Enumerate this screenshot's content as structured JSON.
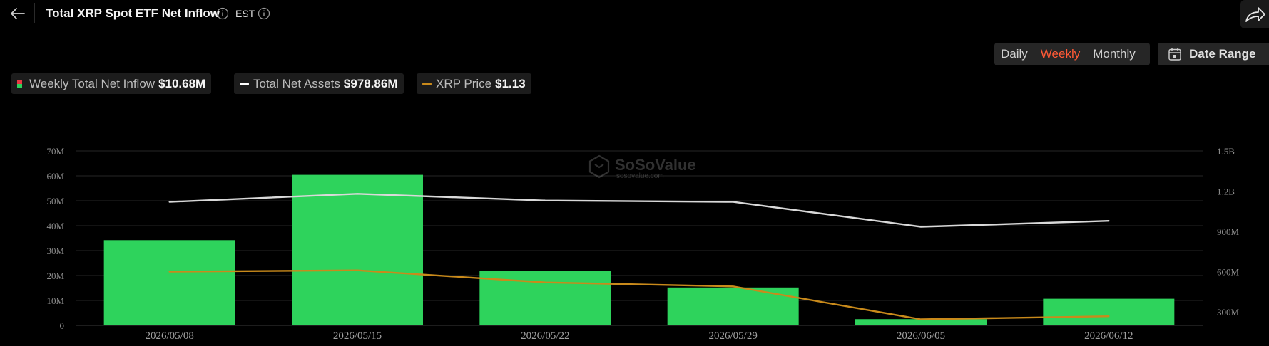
{
  "header": {
    "title": "Total XRP Spot ETF Net Inflow",
    "timezone": "EST"
  },
  "controls": {
    "periods": [
      "Daily",
      "Weekly",
      "Monthly"
    ],
    "active_period": "Weekly",
    "date_range_label": "Date Range"
  },
  "legend": [
    {
      "label": "Weekly Total Net Inflow",
      "value": "$10.68M"
    },
    {
      "label": "Total Net Assets",
      "value": "$978.86M"
    },
    {
      "label": "XRP Price",
      "value": "$1.13"
    }
  ],
  "colors": {
    "bar_positive": "#2ed35c",
    "bar_negative": "#ea3943",
    "net_assets_line": "#d9d9d9",
    "price_line": "#c98a1b",
    "active_tab": "#ff5a36"
  },
  "watermark": {
    "brand": "SoSoValue",
    "url": "sosovalue.com"
  },
  "chart_data": {
    "type": "bar",
    "categories": [
      "2026/05/08",
      "2026/05/15",
      "2026/05/22",
      "2026/05/29",
      "2026/06/05",
      "2026/06/12"
    ],
    "series": [
      {
        "name": "Weekly Total Net Inflow",
        "type": "bar",
        "axis": "left",
        "values": [
          34.2,
          60.4,
          22.0,
          15.2,
          2.5,
          10.68
        ]
      },
      {
        "name": "Total Net Assets",
        "type": "line",
        "axis": "right",
        "values": [
          1.12,
          1.18,
          1.13,
          1.12,
          0.935,
          0.97886
        ]
      },
      {
        "name": "XRP Price",
        "type": "line",
        "axis": "right",
        "values": [
          0.6,
          0.61,
          0.52,
          0.49,
          0.245,
          0.268
        ]
      }
    ],
    "left_axis": {
      "ticks": [
        "0",
        "10M",
        "20M",
        "30M",
        "40M",
        "50M",
        "60M",
        "70M"
      ],
      "range": [
        0,
        70
      ]
    },
    "right_axis": {
      "ticks": [
        "300M",
        "600M",
        "900M",
        "1.2B",
        "1.5B"
      ],
      "range": [
        0.2,
        1.5
      ]
    },
    "grid": true,
    "legend_position": "top-left"
  }
}
